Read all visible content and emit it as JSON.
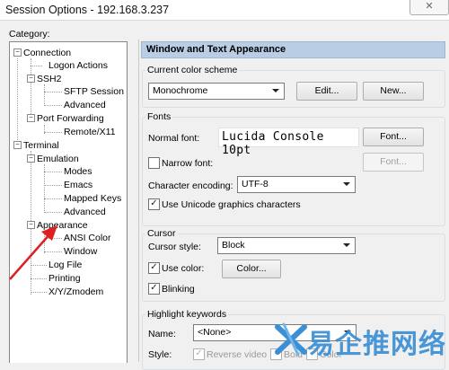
{
  "window": {
    "title": "Session Options - 192.168.3.237",
    "close_label": "✕"
  },
  "category_label": "Category:",
  "tree": [
    {
      "label": "Connection",
      "bullet": "−"
    },
    {
      "label": "Logon Actions"
    },
    {
      "label": "SSH2",
      "bullet": "−"
    },
    {
      "label": "SFTP Session"
    },
    {
      "label": "Advanced"
    },
    {
      "label": "Port Forwarding",
      "bullet": "−"
    },
    {
      "label": "Remote/X11"
    },
    {
      "label": "Terminal",
      "bullet": "−"
    },
    {
      "label": "Emulation",
      "bullet": "−"
    },
    {
      "label": "Modes"
    },
    {
      "label": "Emacs"
    },
    {
      "label": "Mapped Keys"
    },
    {
      "label": "Advanced"
    },
    {
      "label": "Appearance",
      "bullet": "−"
    },
    {
      "label": "ANSI Color"
    },
    {
      "label": "Window"
    },
    {
      "label": "Log File"
    },
    {
      "label": "Printing"
    },
    {
      "label": "X/Y/Zmodem"
    }
  ],
  "main": {
    "header": "Window and Text Appearance",
    "color_scheme": {
      "group_title": "Current color scheme",
      "selected": "Monochrome",
      "edit_label": "Edit...",
      "new_label": "New..."
    },
    "fonts": {
      "group_title": "Fonts",
      "normal_font_label": "Normal font:",
      "normal_font_value": "Lucida Console 10pt",
      "font_button": "Font...",
      "narrow_font_label": "Narrow font:",
      "narrow_font_button": "Font...",
      "encoding_label": "Character encoding:",
      "encoding_value": "UTF-8",
      "unicode_label": "Use Unicode graphics characters",
      "unicode_checked": true,
      "narrow_checked": false
    },
    "cursor": {
      "group_title": "Cursor",
      "style_label": "Cursor style:",
      "style_value": "Block",
      "use_color_label": "Use color:",
      "use_color_checked": true,
      "color_button": "Color...",
      "blinking_label": "Blinking",
      "blinking_checked": true
    },
    "highlight": {
      "group_title": "Highlight keywords",
      "name_label": "Name:",
      "name_value": "<None>",
      "style_label": "Style:",
      "reverse_video_label": "Reverse video",
      "bold_label": "Bold",
      "color_label": "Color"
    }
  },
  "check_glyph": "✓",
  "watermark": {
    "text": "易企推网络",
    "logo_icon": "crossed-x-logo-icon"
  },
  "colors": {
    "header_bg": "#b9cde5",
    "arrow": "#e02020",
    "watermark": "#3b8fd4"
  }
}
